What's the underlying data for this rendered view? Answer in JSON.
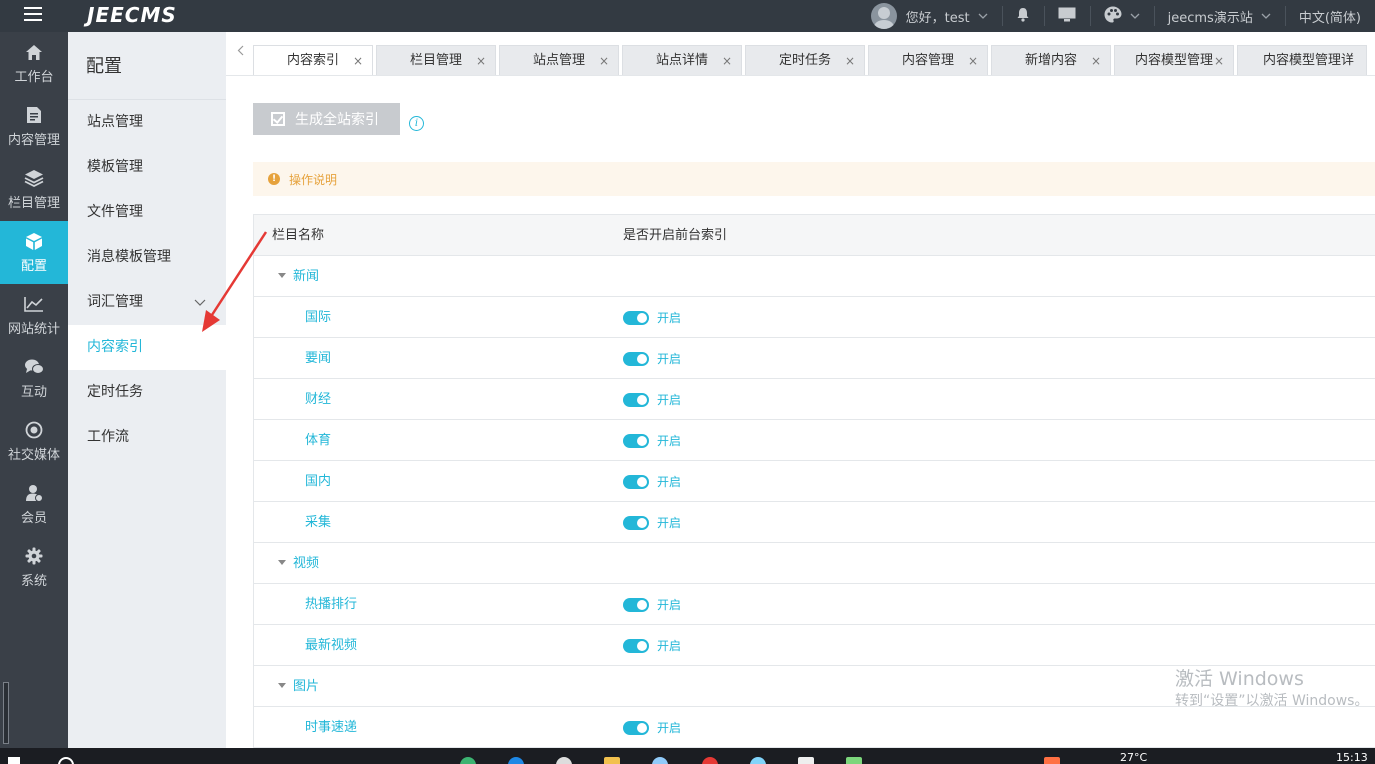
{
  "topbar": {
    "logo": "JEECMS",
    "greeting": "您好，test",
    "site": "jeecms演示站",
    "language": "中文(简体)"
  },
  "leftnav": {
    "items": [
      {
        "label": "工作台",
        "icon": "home-icon"
      },
      {
        "label": "内容管理",
        "icon": "document-icon"
      },
      {
        "label": "栏目管理",
        "icon": "layers-icon"
      },
      {
        "label": "配置",
        "icon": "cube-icon",
        "active": true
      },
      {
        "label": "网站统计",
        "icon": "line-chart-icon"
      },
      {
        "label": "互动",
        "icon": "chat-icon"
      },
      {
        "label": "社交媒体",
        "icon": "target-icon"
      },
      {
        "label": "会员",
        "icon": "member-icon"
      },
      {
        "label": "系统",
        "icon": "gear-icon"
      }
    ]
  },
  "submenu": {
    "title": "配置",
    "items": [
      {
        "label": "站点管理"
      },
      {
        "label": "模板管理"
      },
      {
        "label": "文件管理"
      },
      {
        "label": "消息模板管理"
      },
      {
        "label": "词汇管理"
      },
      {
        "label": "内容索引",
        "active": true
      },
      {
        "label": "定时任务"
      },
      {
        "label": "工作流"
      }
    ]
  },
  "tabs": [
    {
      "label": "内容索引",
      "active": true
    },
    {
      "label": "栏目管理"
    },
    {
      "label": "站点管理"
    },
    {
      "label": "站点详情"
    },
    {
      "label": "定时任务"
    },
    {
      "label": "内容管理"
    },
    {
      "label": "新增内容"
    },
    {
      "label": "内容模型管理"
    },
    {
      "label": "内容模型管理详"
    }
  ],
  "tab_close_glyph": "×",
  "main": {
    "generate_button": "生成全站索引",
    "info_glyph": "i",
    "notice_glyph": "!",
    "notice": "操作说明",
    "table": {
      "headers": [
        "栏目名称",
        "是否开启前台索引"
      ],
      "switch_label": "开启",
      "rows": [
        {
          "type": "group",
          "name": "新闻"
        },
        {
          "type": "leaf",
          "name": "国际",
          "enabled": true
        },
        {
          "type": "leaf",
          "name": "要闻",
          "enabled": true
        },
        {
          "type": "leaf",
          "name": "财经",
          "enabled": true
        },
        {
          "type": "leaf",
          "name": "体育",
          "enabled": true
        },
        {
          "type": "leaf",
          "name": "国内",
          "enabled": true
        },
        {
          "type": "leaf",
          "name": "采集",
          "enabled": true
        },
        {
          "type": "group",
          "name": "视频"
        },
        {
          "type": "leaf",
          "name": "热播排行",
          "enabled": true
        },
        {
          "type": "leaf",
          "name": "最新视频",
          "enabled": true
        },
        {
          "type": "group",
          "name": "图片"
        },
        {
          "type": "leaf",
          "name": "时事速递",
          "enabled": true
        }
      ]
    }
  },
  "watermark": {
    "line1": "激活 Windows",
    "line2": "转到“设置”以激活 Windows。"
  },
  "taskbar": {
    "temperature": "27°C",
    "time": "15:13"
  },
  "colors": {
    "accent": "#23b7d8",
    "topbar": "#333a42",
    "leftnav": "#3a4048",
    "submenu": "#ebeef2",
    "notice_bg": "#fdf6ec",
    "notice_text": "#e6a23c",
    "annotation_arrow": "#e53935"
  }
}
